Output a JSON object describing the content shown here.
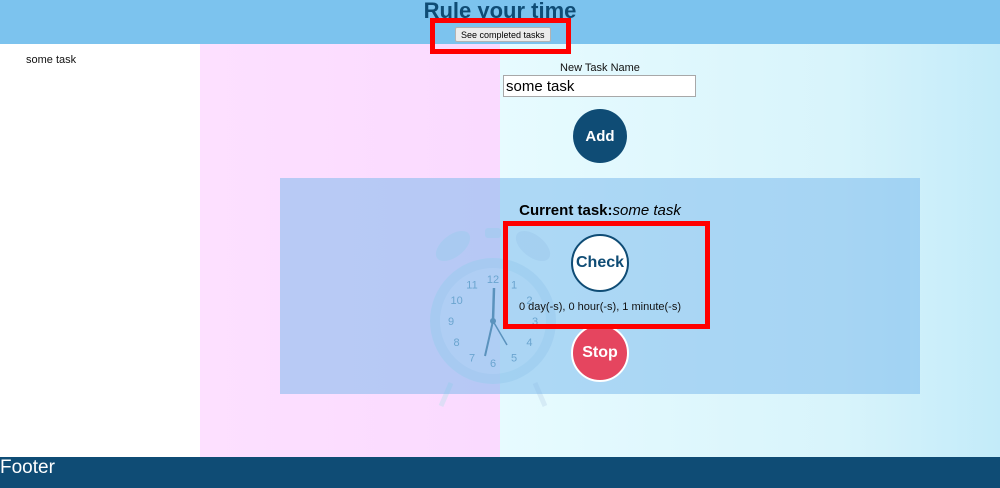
{
  "header": {
    "title": "Rule your time",
    "completed_button": "See completed tasks"
  },
  "sidebar": {
    "task": "some task"
  },
  "form": {
    "label": "New Task Name",
    "value": "some task",
    "add_label": "Add"
  },
  "current": {
    "prefix": "Current task:",
    "name": "some task",
    "check_label": "Check",
    "elapsed": "0 day(-s), 0 hour(-s), 1 minute(-s)",
    "stop_label": "Stop"
  },
  "clock_digits": [
    "12",
    "1",
    "2",
    "3",
    "4",
    "5",
    "6",
    "7",
    "8",
    "9",
    "10",
    "11"
  ],
  "footer": {
    "text": "Footer"
  }
}
